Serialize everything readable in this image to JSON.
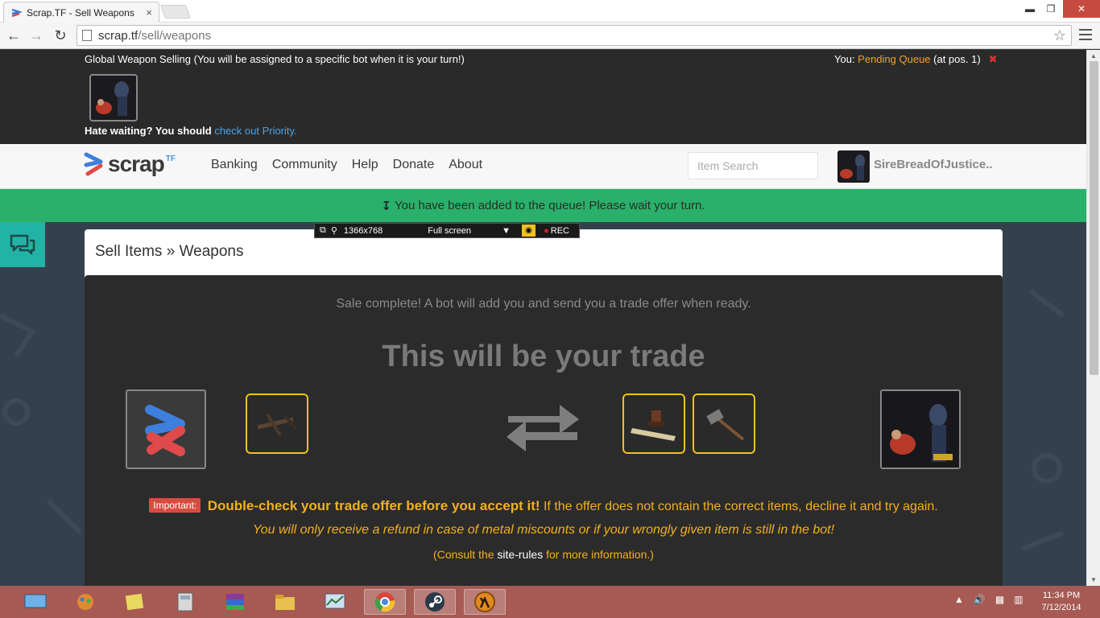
{
  "browser": {
    "tab_title": "Scrap.TF - Sell Weapons",
    "tab_close": "×",
    "url_host": "scrap.tf",
    "url_path": "/sell/weapons",
    "win_min": "▬",
    "win_max": "❐",
    "win_close": "✕"
  },
  "queue": {
    "title": "Global Weapon Selling  (You will be assigned to a specific bot when it is your turn!)",
    "you_label": "You: ",
    "status": "Pending Queue",
    "position": " (at pos. 1)",
    "priority_text": "Hate waiting? You should ",
    "priority_link": "check out Priority."
  },
  "header": {
    "logo_text": "scrap",
    "logo_tf": "TF",
    "nav": [
      "Banking",
      "Community",
      "Help",
      "Donate",
      "About"
    ],
    "search_placeholder": "Item Search",
    "username": "SireBreadOfJustice.."
  },
  "notice": {
    "text": "You have been added to the queue! Please wait your turn."
  },
  "recorder": {
    "resolution": "1366x768",
    "mode": "Full screen",
    "rec": "REC"
  },
  "content": {
    "breadcrumb_parent": "Sell Items",
    "breadcrumb_sep": "»",
    "breadcrumb_current": "Weapons",
    "sale_message": "Sale complete! A bot will add you and send you a trade offer when ready.",
    "trade_heading": "This will be your trade",
    "important_badge": "Important:",
    "important_bold": "Double-check your trade offer before you accept it!",
    "important_rest": " If the offer does not contain the correct items, decline it and try again.",
    "refund_text": "You will only receive a refund in case of metal miscounts or if your wrongly given item is still in the bot!",
    "consult_prefix": "(Consult the ",
    "consult_link": "site-rules",
    "consult_suffix": " for more information.)"
  },
  "taskbar": {
    "time": "11:34 PM",
    "date": "7/12/2014"
  },
  "colors": {
    "accent_green": "#2ab06a",
    "gold": "#f0b020",
    "link_blue": "#4ba2e8",
    "taskbar": "#a65a53"
  }
}
